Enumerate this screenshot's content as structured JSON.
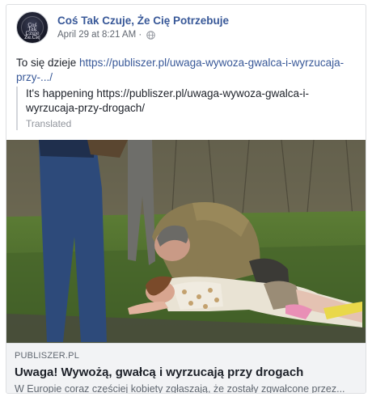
{
  "post": {
    "page_name": "Coś Tak Czuje, Że Cię Potrzebuje",
    "timestamp": "April 29 at 8:21 AM",
    "meta_separator": " · ",
    "avatar_text": "Coś Tak Czuje Że Cię",
    "text_prefix": "To się dzieje ",
    "text_link": "https://publiszer.pl/uwaga-wywoza-gwalca-i-wyrzucaja-przy-.../",
    "translation_text": "It's happening https://publiszer.pl/uwaga-wywoza-gwalca-i-wyrzucaja-przy-drogach/",
    "translated_label": "Translated",
    "privacy_icon": "globe-icon"
  },
  "link_preview": {
    "domain": "PUBLISZER.PL",
    "title": "Uwaga! Wywożą, gwałcą i wyrzucają przy drogach",
    "description": "W Europie coraz częściej kobiety zgłaszają, że zostały zgwałcone przez...",
    "image_subject": "photo-man-kneeling-over-woman-lying-on-grass"
  },
  "colors": {
    "link": "#385898",
    "text": "#1d2129",
    "meta": "#616770",
    "caption_bg": "#f2f3f5"
  }
}
